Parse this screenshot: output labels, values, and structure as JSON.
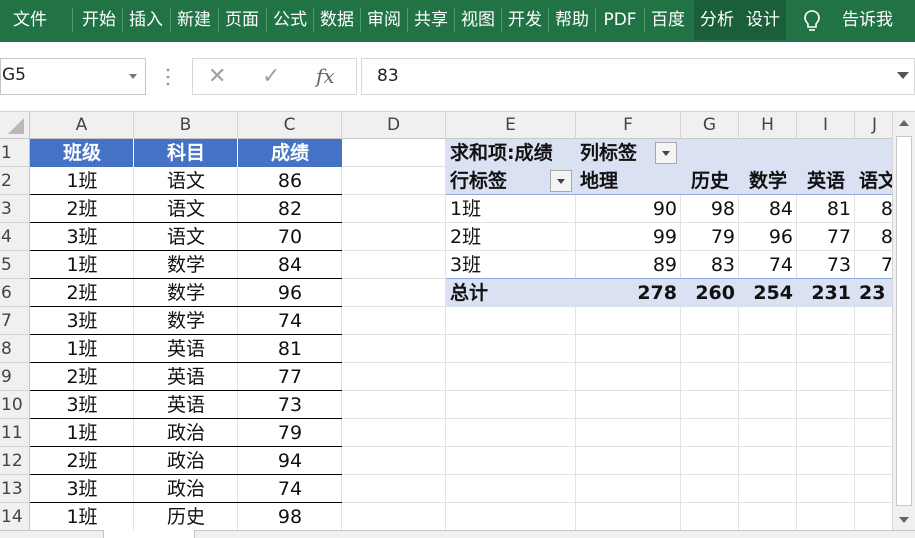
{
  "ribbon": {
    "tabs": [
      "文件",
      "开始",
      "插入",
      "新建",
      "页面",
      "公式",
      "数据",
      "审阅",
      "共享",
      "视图",
      "开发",
      "帮助",
      "PDF",
      "百度",
      "分析",
      "设计"
    ],
    "tell_me": "告诉我",
    "active_tab_color": "#1b5e3a",
    "ribbon_color": "#217346"
  },
  "formula_bar": {
    "name_box": "G5",
    "value": "83",
    "fx_label": "fx"
  },
  "columns": [
    "A",
    "B",
    "C",
    "D",
    "E",
    "F",
    "G",
    "H",
    "I",
    "J"
  ],
  "rows": [
    "1",
    "2",
    "3",
    "4",
    "5",
    "6",
    "7",
    "8",
    "9",
    "10",
    "11",
    "12",
    "13",
    "14"
  ],
  "source_table": {
    "headers": [
      "班级",
      "科目",
      "成绩"
    ],
    "header_color": "#4472c4",
    "rows": [
      [
        "1班",
        "语文",
        "86"
      ],
      [
        "2班",
        "语文",
        "82"
      ],
      [
        "3班",
        "语文",
        "70"
      ],
      [
        "1班",
        "数学",
        "84"
      ],
      [
        "2班",
        "数学",
        "96"
      ],
      [
        "3班",
        "数学",
        "74"
      ],
      [
        "1班",
        "英语",
        "81"
      ],
      [
        "2班",
        "英语",
        "77"
      ],
      [
        "3班",
        "英语",
        "73"
      ],
      [
        "1班",
        "政治",
        "79"
      ],
      [
        "2班",
        "政治",
        "94"
      ],
      [
        "3班",
        "政治",
        "74"
      ],
      [
        "1班",
        "历史",
        "98"
      ]
    ]
  },
  "pivot": {
    "value_label": "求和项:成绩",
    "col_label": "列标签",
    "row_label": "行标签",
    "band_color": "#d9e1f2",
    "columns": [
      "地理",
      "历史",
      "数学",
      "英语",
      "语文"
    ],
    "rows": [
      {
        "label": "1班",
        "values": [
          "90",
          "98",
          "84",
          "81",
          "8"
        ]
      },
      {
        "label": "2班",
        "values": [
          "99",
          "79",
          "96",
          "77",
          "8"
        ]
      },
      {
        "label": "3班",
        "values": [
          "89",
          "83",
          "74",
          "73",
          "7"
        ]
      }
    ],
    "total": {
      "label": "总计",
      "values": [
        "278",
        "260",
        "254",
        "231",
        "23"
      ]
    }
  }
}
